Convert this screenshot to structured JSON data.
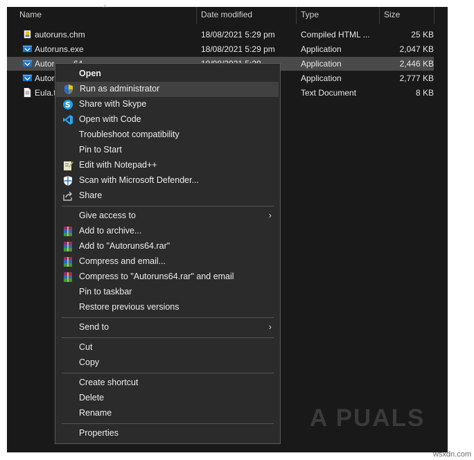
{
  "header": {
    "columns": [
      {
        "label": "Name"
      },
      {
        "label": "Date modified"
      },
      {
        "label": "Type"
      },
      {
        "label": "Size"
      }
    ],
    "sort_glyph": "^"
  },
  "files": [
    {
      "name": "autoruns.chm",
      "date": "18/08/2021 5:29 pm",
      "type": "Compiled HTML ...",
      "size": "25 KB",
      "icon": "chm-file-icon"
    },
    {
      "name": "Autoruns.exe",
      "date": "18/08/2021 5:29 pm",
      "type": "Application",
      "size": "2,047 KB",
      "icon": "app-file-icon"
    },
    {
      "name": "Autor",
      "name_tail": "64",
      "date": "18/08/2021 5:29",
      "type": "Application",
      "size": "2,446 KB",
      "icon": "app-file-icon",
      "selected": true
    },
    {
      "name": "Autor",
      "date": "",
      "type": "Application",
      "size": "2,777 KB",
      "icon": "app-file-icon"
    },
    {
      "name": "Eula.t",
      "date": "",
      "type": "Text Document",
      "size": "8 KB",
      "icon": "text-file-icon"
    }
  ],
  "context_menu": {
    "items": [
      {
        "label": "Open",
        "bold": true
      },
      {
        "label": "Run as administrator",
        "icon": "shield-icon",
        "hover": true
      },
      {
        "label": "Share with Skype",
        "icon": "skype-icon"
      },
      {
        "label": "Open with Code",
        "icon": "vscode-icon"
      },
      {
        "label": "Troubleshoot compatibility"
      },
      {
        "label": "Pin to Start"
      },
      {
        "label": "Edit with Notepad++",
        "icon": "notepadpp-icon"
      },
      {
        "label": "Scan with Microsoft Defender...",
        "icon": "defender-icon"
      },
      {
        "label": "Share",
        "icon": "share-icon"
      },
      {
        "label": "Give access to",
        "submenu": true
      },
      {
        "label": "Add to archive...",
        "icon": "winrar-icon"
      },
      {
        "label": "Add to \"Autoruns64.rar\"",
        "icon": "winrar-icon"
      },
      {
        "label": "Compress and email...",
        "icon": "winrar-icon"
      },
      {
        "label": "Compress to \"Autoruns64.rar\" and email",
        "icon": "winrar-icon"
      },
      {
        "label": "Pin to taskbar"
      },
      {
        "label": "Restore previous versions"
      },
      {
        "label": "Send to",
        "submenu": true
      },
      {
        "label": "Cut"
      },
      {
        "label": "Copy"
      },
      {
        "label": "Create shortcut"
      },
      {
        "label": "Delete"
      },
      {
        "label": "Rename"
      },
      {
        "label": "Properties"
      }
    ],
    "submenu_glyph": "›"
  },
  "watermark": "A PUALS",
  "site": "wsxdn.com",
  "colors": {
    "background": "#191919",
    "menu_bg": "#2b2b2b",
    "selection": "#4a4a4a",
    "hover": "#414141",
    "text": "#e6e6e6"
  }
}
